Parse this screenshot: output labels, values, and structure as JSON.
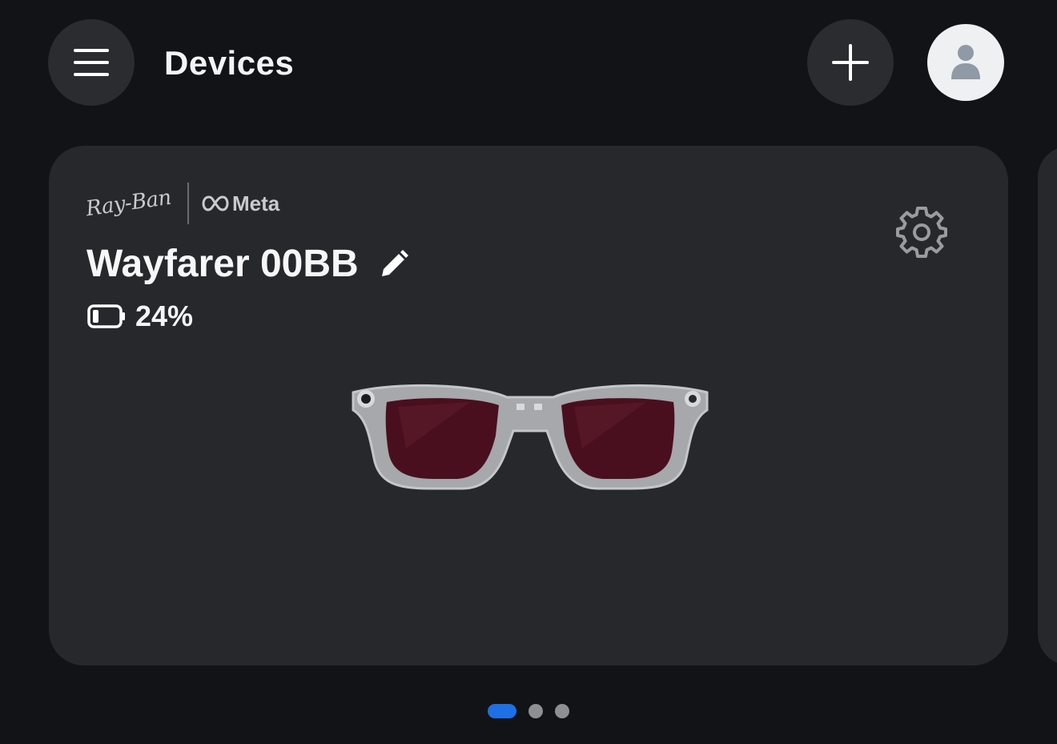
{
  "header": {
    "title": "Devices",
    "menu_icon": "hamburger-menu-icon",
    "add_icon": "plus-icon",
    "avatar_icon": "person-icon"
  },
  "device_card": {
    "brand_primary": "Ray-Ban",
    "brand_secondary": "Meta",
    "device_name": "Wayfarer 00BB",
    "edit_icon": "pencil-icon",
    "battery_icon": "battery-low-icon",
    "battery_level": "24%",
    "battery_fraction": 0.24,
    "settings_icon": "gear-icon",
    "image": "glasses-image"
  },
  "pagination": {
    "page_count": 3,
    "active_index": 0
  },
  "colors": {
    "background": "#121316",
    "card": "#27282b",
    "button": "#2b2c30",
    "accent": "#1f6fe5"
  }
}
